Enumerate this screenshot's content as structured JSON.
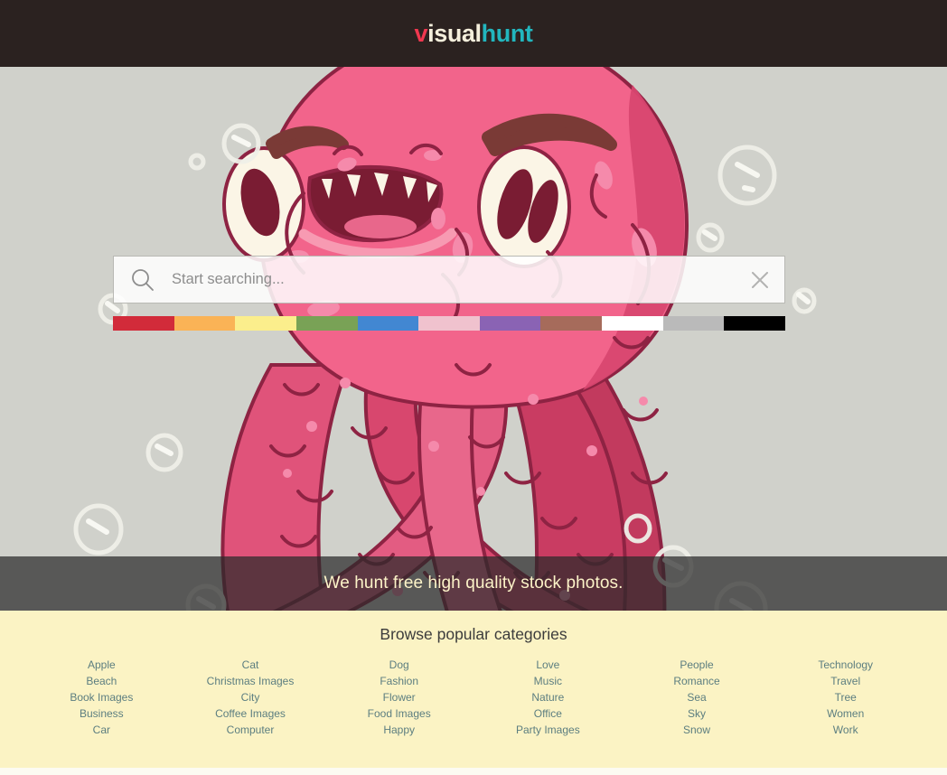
{
  "header": {
    "logo": {
      "part1": "v",
      "part2": "isual",
      "part3": "hunt"
    },
    "background_color": "#2B2220",
    "colors": {
      "v": "#F0384F",
      "isual": "#F5EFDC",
      "hunt": "#22B6BE"
    }
  },
  "hero": {
    "background_color": "#D0D1CB",
    "illustration": "pink-octopus-monster",
    "search": {
      "placeholder": "Start searching...",
      "value": "",
      "search_icon": "search-icon",
      "clear_icon": "close-x-icon"
    },
    "color_filters": [
      {
        "name": "red",
        "hex": "#D22B3A"
      },
      {
        "name": "orange",
        "hex": "#FAB356"
      },
      {
        "name": "yellow",
        "hex": "#FBEE8C"
      },
      {
        "name": "green",
        "hex": "#79A256"
      },
      {
        "name": "blue",
        "hex": "#4287D2"
      },
      {
        "name": "pink",
        "hex": "#F0C2CE"
      },
      {
        "name": "purple",
        "hex": "#8A63B4"
      },
      {
        "name": "brown",
        "hex": "#A66B5B"
      },
      {
        "name": "white",
        "hex": "#FFFFFF"
      },
      {
        "name": "gray",
        "hex": "#BABABA"
      },
      {
        "name": "black",
        "hex": "#000000"
      }
    ]
  },
  "tagline": {
    "text": "We hunt free high quality stock photos.",
    "text_color": "#FCF3C8",
    "background_color": "rgba(42,42,42,0.72)"
  },
  "categories": {
    "heading": "Browse popular categories",
    "background_color": "#FBF3C4",
    "link_color": "#5C7E80",
    "columns": [
      {
        "items": [
          "Apple",
          "Beach",
          "Book Images",
          "Business",
          "Car"
        ]
      },
      {
        "items": [
          "Cat",
          "Christmas Images",
          "City",
          "Coffee Images",
          "Computer"
        ]
      },
      {
        "items": [
          "Dog",
          "Fashion",
          "Flower",
          "Food Images",
          "Happy"
        ]
      },
      {
        "items": [
          "Love",
          "Music",
          "Nature",
          "Office",
          "Party Images"
        ]
      },
      {
        "items": [
          "People",
          "Romance",
          "Sea",
          "Sky",
          "Snow"
        ]
      },
      {
        "items": [
          "Technology",
          "Travel",
          "Tree",
          "Women",
          "Work"
        ]
      }
    ]
  }
}
